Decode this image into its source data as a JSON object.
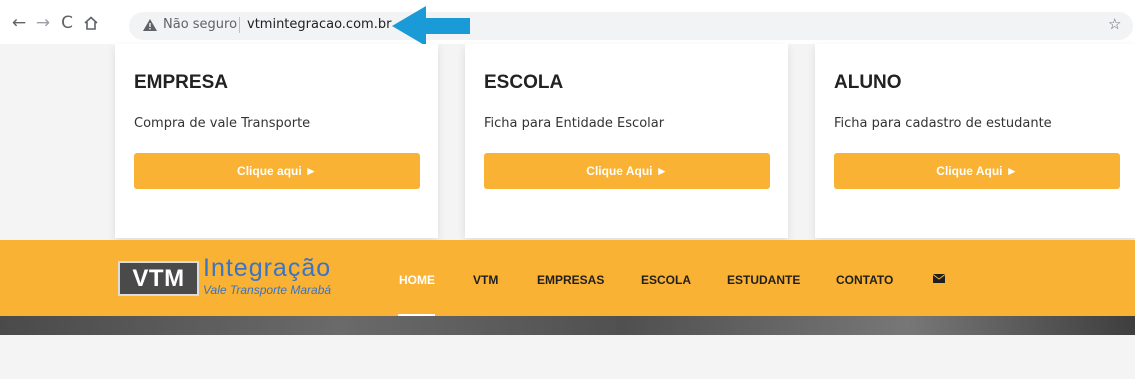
{
  "browser": {
    "security_label": "Não seguro",
    "url": "vtmintegracao.com.br"
  },
  "cards": [
    {
      "title": "EMPRESA",
      "description": "Compra de vale Transporte",
      "button": "Clique aqui ►"
    },
    {
      "title": "ESCOLA",
      "description": "Ficha para Entidade Escolar",
      "button": "Clique Aqui ►"
    },
    {
      "title": "ALUNO",
      "description": "Ficha para cadastro de estudante",
      "button": "Clique Aqui ►"
    }
  ],
  "header": {
    "logo": {
      "box_text": "VTM",
      "word": "Integração",
      "subtitle": "Vale Transporte Marabá"
    },
    "menu": [
      "HOME",
      "VTM",
      "EMPRESAS",
      "ESCOLA",
      "ESTUDANTE",
      "CONTATO"
    ],
    "active_item": "HOME"
  },
  "colors": {
    "accent": "#f9b233",
    "logo_blue": "#3a74c4",
    "annotation_arrow": "#1a9bd7"
  },
  "icons": [
    "back-arrow-icon",
    "forward-arrow-icon",
    "reload-icon",
    "home-icon",
    "warning-icon",
    "bookmark-star-icon",
    "envelope-icon"
  ]
}
